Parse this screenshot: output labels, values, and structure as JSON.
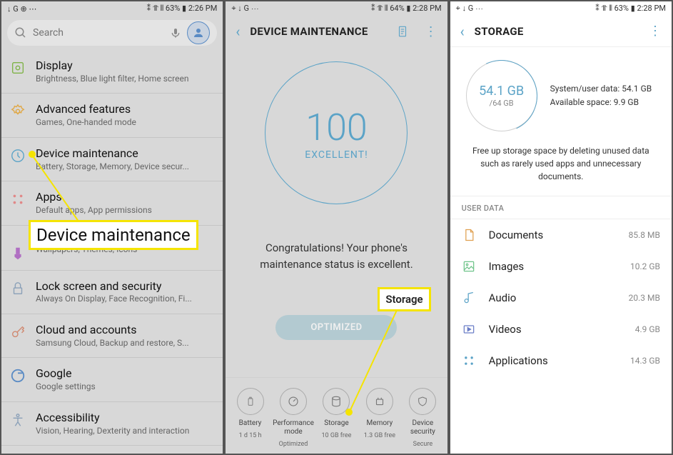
{
  "screen1": {
    "status": {
      "left": "↓ G ⊕ ⋯",
      "right": "⁑ ⥣ ⫴ 63% ▮ 2:26 PM"
    },
    "search_placeholder": "Search",
    "items": [
      {
        "title": "Display",
        "sub": "Brightness, Blue light filter, Home screen",
        "icon_color": "#7fb348"
      },
      {
        "title": "Advanced features",
        "sub": "Games, One-handed mode",
        "icon_color": "#e0a846"
      },
      {
        "title": "Device maintenance",
        "sub": "Battery, Storage, Memory, Device secur...",
        "icon_color": "#5ba3c7"
      },
      {
        "title": "Apps",
        "sub": "Default apps, App permissions",
        "icon_color": "#e08888"
      },
      {
        "title": "",
        "sub": "Wallpapers, Themes, Icons",
        "icon_color": "#b06fc2"
      },
      {
        "title": "Lock screen and security",
        "sub": "Always On Display, Face Recognition, Fi...",
        "icon_color": "#8aa0b8"
      },
      {
        "title": "Cloud and accounts",
        "sub": "Samsung Cloud, Backup and restore, S...",
        "icon_color": "#d0886f"
      },
      {
        "title": "Google",
        "sub": "Google settings",
        "icon_color": "#5a8bc4"
      },
      {
        "title": "Accessibility",
        "sub": "Vision, Hearing, Dexterity and interaction",
        "icon_color": "#8aa0b8"
      }
    ],
    "highlight_label": "Device maintenance"
  },
  "screen2": {
    "status": {
      "left": "⌖ ↓ G ⋯",
      "right": "⁑ ⥣ ⫴ 64% ▮ 2:28 PM"
    },
    "header": "DEVICE MAINTENANCE",
    "score": "100",
    "score_label": "EXCELLENT!",
    "congrats": "Congratulations! Your phone's maintenance status is excellent.",
    "opt_button": "OPTIMIZED",
    "bottom": [
      {
        "label": "Battery",
        "sub": "1 d 15 h"
      },
      {
        "label": "Performance mode",
        "sub": "Optimized"
      },
      {
        "label": "Storage",
        "sub": "10 GB free"
      },
      {
        "label": "Memory",
        "sub": "1.3 GB free"
      },
      {
        "label": "Device security",
        "sub": "Secure"
      }
    ],
    "highlight_label": "Storage"
  },
  "screen3": {
    "status": {
      "left": "⌖ ↓ G ⋯",
      "right": "⁑ ⥣ ⫴ 63% ▮ 2:28 PM"
    },
    "header": "STORAGE",
    "used": "54.1 GB",
    "total": "/64 GB",
    "meta1": "System/user data: 54.1 GB",
    "meta2": "Available space: 9.9 GB",
    "hint": "Free up storage space by deleting unused data such as rarely used apps and unnecessary documents.",
    "section": "USER DATA",
    "items": [
      {
        "label": "Documents",
        "size": "85.8 MB",
        "color": "#e0a050"
      },
      {
        "label": "Images",
        "size": "10.2 GB",
        "color": "#6fc48a"
      },
      {
        "label": "Audio",
        "size": "20.3 MB",
        "color": "#5ba3c7"
      },
      {
        "label": "Videos",
        "size": "4.9 GB",
        "color": "#6a7dc7"
      },
      {
        "label": "Applications",
        "size": "14.3 GB",
        "color": "#5ba3c7"
      }
    ]
  }
}
